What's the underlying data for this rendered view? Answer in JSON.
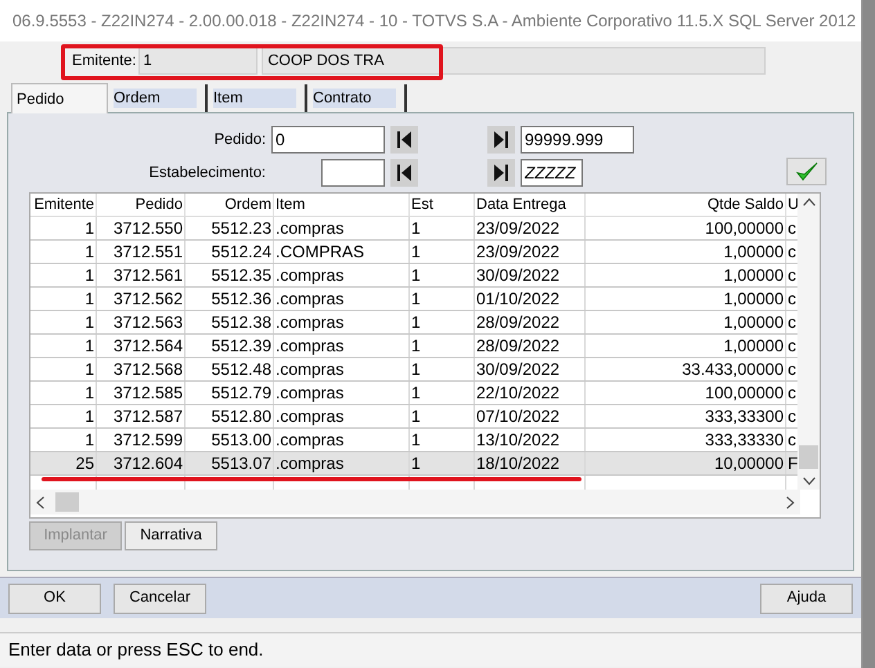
{
  "window": {
    "title": "06.9.5553 - Z22IN274 - 2.00.00.018 - Z22IN274 - 10 - TOTVS S.A - Ambiente Corporativo 11.5.X SQL Server 2012"
  },
  "header": {
    "label": "Emitente:",
    "code": "1",
    "name": "COOP DOS TRA"
  },
  "tabs": [
    {
      "label": "Pedido",
      "selected": true
    },
    {
      "label": "Ordem",
      "selected": false
    },
    {
      "label": "Item",
      "selected": false
    },
    {
      "label": "Contrato",
      "selected": false
    }
  ],
  "filters": [
    {
      "label": "Pedido:",
      "from": "0",
      "to": "99999.999"
    },
    {
      "label": "Estabelecimento:",
      "to": "ZZZZZ"
    }
  ],
  "table": {
    "columns": [
      "Emitente",
      "Pedido",
      "Ordem",
      "Item",
      "Est",
      "Data Entrega",
      "Qtde Saldo",
      "U"
    ],
    "rows": [
      {
        "selected": false,
        "cells": [
          "1",
          "3712.550",
          "5512.23",
          ".compras",
          "1",
          "23/09/2022",
          "100,00000",
          "c"
        ]
      },
      {
        "selected": false,
        "cells": [
          "1",
          "3712.551",
          "5512.24",
          ".COMPRAS",
          "1",
          "23/09/2022",
          "1,00000",
          "c"
        ]
      },
      {
        "selected": false,
        "cells": [
          "1",
          "3712.561",
          "5512.35",
          ".compras",
          "1",
          "30/09/2022",
          "1,00000",
          "c"
        ]
      },
      {
        "selected": false,
        "cells": [
          "1",
          "3712.562",
          "5512.36",
          ".compras",
          "1",
          "01/10/2022",
          "1,00000",
          "c"
        ]
      },
      {
        "selected": false,
        "cells": [
          "1",
          "3712.563",
          "5512.38",
          ".compras",
          "1",
          "28/09/2022",
          "1,00000",
          "c"
        ]
      },
      {
        "selected": false,
        "cells": [
          "1",
          "3712.564",
          "5512.39",
          ".compras",
          "1",
          "28/09/2022",
          "1,00000",
          "c"
        ]
      },
      {
        "selected": false,
        "cells": [
          "1",
          "3712.568",
          "5512.48",
          ".compras",
          "1",
          "30/09/2022",
          "33.433,00000",
          "c"
        ]
      },
      {
        "selected": false,
        "cells": [
          "1",
          "3712.585",
          "5512.79",
          ".compras",
          "1",
          "22/10/2022",
          "100,00000",
          "c"
        ]
      },
      {
        "selected": false,
        "cells": [
          "1",
          "3712.587",
          "5512.80",
          ".compras",
          "1",
          "07/10/2022",
          "333,33300",
          "c"
        ]
      },
      {
        "selected": false,
        "cells": [
          "1",
          "3712.599",
          "5513.00",
          ".compras",
          "1",
          "13/10/2022",
          "333,33330",
          "c"
        ]
      },
      {
        "selected": true,
        "cells": [
          "25",
          "3712.604",
          "5513.07",
          ".compras",
          "1",
          "18/10/2022",
          "10,00000",
          "F"
        ]
      }
    ]
  },
  "grid_buttons": [
    {
      "label": "Implantar",
      "disabled": true
    },
    {
      "label": "Narrativa",
      "disabled": false
    }
  ],
  "buttons": [
    {
      "label": "OK"
    },
    {
      "label": "Cancelar"
    },
    {
      "label": "Ajuda"
    }
  ],
  "status_bar": "Enter data or press ESC to end."
}
